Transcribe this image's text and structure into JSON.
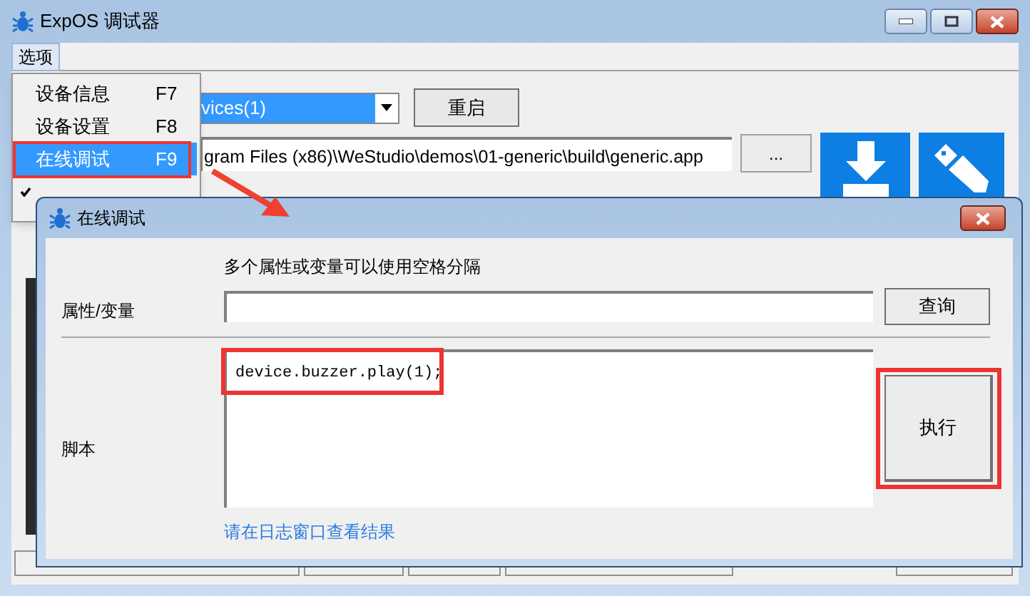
{
  "window": {
    "title": "ExpOS 调试器"
  },
  "menubar": [
    {
      "label": "选项",
      "selected": true
    }
  ],
  "menu": {
    "items": [
      {
        "label": "设备信息",
        "shortcut": "F7",
        "selected": false,
        "checked": false
      },
      {
        "label": "设备设置",
        "shortcut": "F8",
        "selected": false,
        "checked": false
      },
      {
        "label": "在线调试",
        "shortcut": "F9",
        "selected": true,
        "checked": false
      },
      {
        "checked": true
      }
    ]
  },
  "toolbar": {
    "device": "vices(1)",
    "restart_button": "重启",
    "path": "gram Files (x86)\\WeStudio\\demos\\01-generic\\build\\generic.app",
    "browse_button": "..."
  },
  "dialog": {
    "title": "在线调试",
    "hint": "多个属性或变量可以使用空格分隔",
    "property_label": "属性/变量",
    "query_button": "查询",
    "script_label": "脚本",
    "script": "device.buzzer.play(1);",
    "run_button": "执行",
    "result_link": "请在日志窗口查看结果"
  }
}
